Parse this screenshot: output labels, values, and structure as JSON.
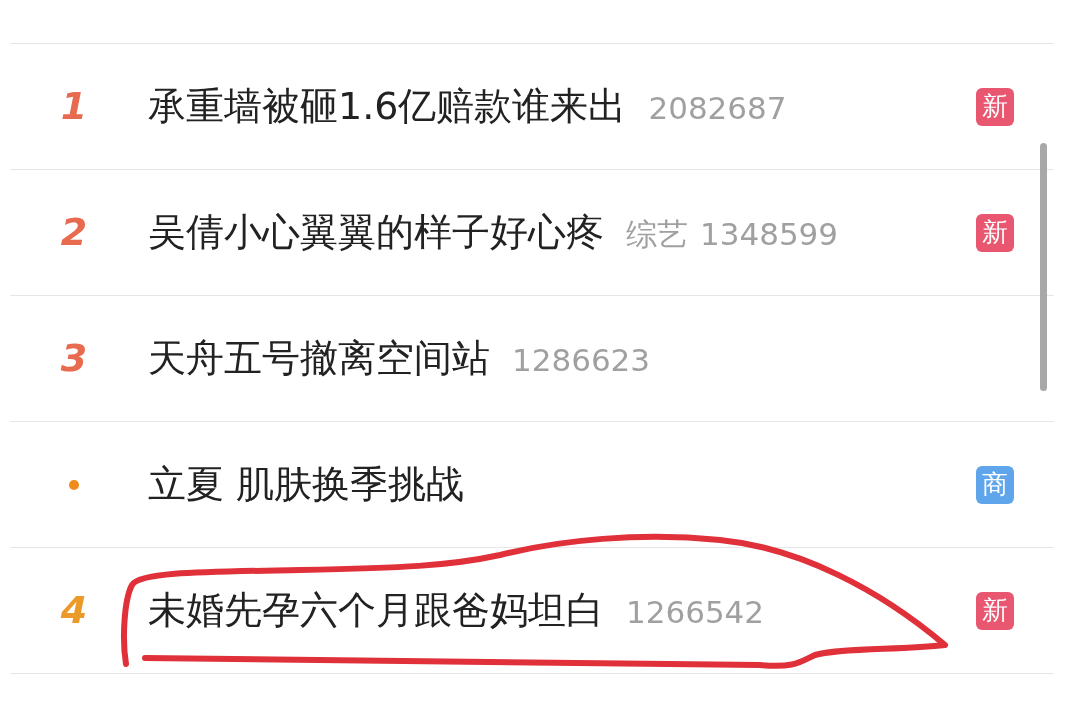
{
  "hot_list": [
    {
      "kind": "rank",
      "rank": "1",
      "color": "#e86a4f",
      "title": "承重墙被砸1.6亿赔款谁来出",
      "count": "2082687",
      "badge": {
        "text": "新",
        "color": "#e8566f"
      }
    },
    {
      "kind": "rank",
      "rank": "2",
      "color": "#e86a4f",
      "title": "吴倩小心翼翼的样子好心疼",
      "category": "综艺",
      "count": "1348599",
      "badge": {
        "text": "新",
        "color": "#e8566f"
      }
    },
    {
      "kind": "rank",
      "rank": "3",
      "color": "#e86a4f",
      "title": "天舟五号撤离空间站",
      "count": "1286623"
    },
    {
      "kind": "promoted",
      "color": "#f08a1c",
      "title": "立夏 肌肤换季挑战",
      "badge": {
        "text": "商",
        "color": "#5ea5ec"
      }
    },
    {
      "kind": "rank",
      "rank": "4",
      "color": "#eb9a2a",
      "title": "未婚先孕六个月跟爸妈坦白",
      "count": "1266542",
      "badge": {
        "text": "新",
        "color": "#e8566f"
      }
    }
  ]
}
